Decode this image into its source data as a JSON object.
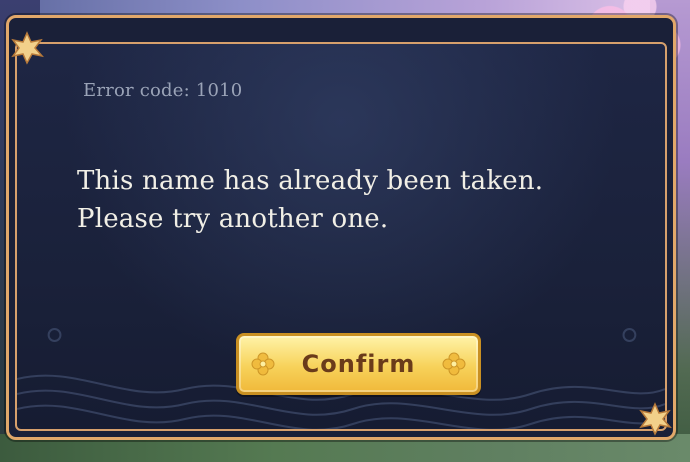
{
  "dialog": {
    "error_code": "Error code: 1010",
    "message": "This name has already been taken. Please try another one.",
    "confirm_label": "Confirm"
  },
  "colors": {
    "panel": "#1a2038",
    "border_gold": "#e2a86a",
    "text": "#f1efe6",
    "subtext": "#9aa3b7",
    "button_gold": "#f7d25a",
    "button_text": "#6a3b1a"
  },
  "icons": {
    "corner": "maple-leaf-icon",
    "button_ornament": "flower-icon"
  }
}
